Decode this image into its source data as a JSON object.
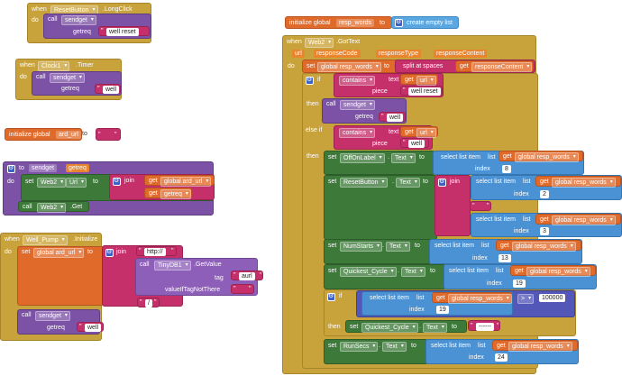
{
  "colors": {
    "event": "#c8a23a",
    "procedure": "#7c52a6",
    "variable": "#e06a2a",
    "component_setter": "#3d7a3a",
    "list": "#4a92d4",
    "text": "#c5306a",
    "control": "#c8a23a",
    "math": "#5257b8"
  },
  "block_reset": {
    "when": "when",
    "component": "ResetButton",
    "event": ".LongClick",
    "do": "do",
    "call": "call",
    "proc": "sendget",
    "param": "getreq",
    "value": "well reset"
  },
  "block_timer": {
    "when": "when",
    "component": "Clock1",
    "event": ".Timer",
    "do": "do",
    "call": "call",
    "proc": "sendget",
    "param": "getreq",
    "value": "well"
  },
  "block_init_url": {
    "label": "initialize global",
    "name": "ard_url",
    "to": "to",
    "value": " "
  },
  "block_proc": {
    "to": "to",
    "name": "sendget",
    "param": "getreq",
    "do": "do",
    "set": "set",
    "component": "Web2",
    "property": "Url",
    "to2": "to",
    "join": "join",
    "get1": "get",
    "var1": "global ard_url",
    "get2": "get",
    "var2": "getreq",
    "call": "call",
    "call_component": "Web2",
    "method": ".Get"
  },
  "block_init_pump": {
    "when": "when",
    "component": "Well_Pump",
    "event": ".Initialize",
    "do": "do",
    "set": "set",
    "var": "global ard_url",
    "to": "to",
    "join": "join",
    "text1": "http://",
    "call": "call",
    "db": "TinyDB1",
    "method": ".GetValue",
    "tag_label": "tag",
    "tag": "aurl",
    "vitnt": "valueIfTagNotThere",
    "vitnt_value": " ",
    "text3": "/",
    "call2": "call",
    "proc": "sendget",
    "param": "getreq",
    "value": "well"
  },
  "block_init_resp": {
    "label": "initialize global",
    "name": "resp_words",
    "to": "to",
    "value": "create empty list"
  },
  "block_gottext": {
    "when": "when",
    "component": "Web2",
    "event": ".GotText",
    "params": [
      "url",
      "responseCode",
      "responseType",
      "responseContent"
    ],
    "do": "do",
    "set": "set",
    "var": "global resp_words",
    "to": "to",
    "split": "split at spaces",
    "get": "get",
    "content": "responseContent",
    "if": "if",
    "contains": "contains",
    "contains_mode": "text",
    "text_label": "text",
    "piece_label": "piece",
    "get_url": "get",
    "url_var": "url",
    "piece1": "well reset",
    "then": "then",
    "call": "call",
    "call_proc": "sendget",
    "getreq": "getreq",
    "call_value": "well",
    "else_if": "else if",
    "piece2": "well",
    "select": "select list item",
    "list_label": "list",
    "index_label": "index",
    "resp_var": "global resp_words",
    "text_prop": "Text",
    "comp_offon": "OffOnLabel",
    "comp_reset": "ResetButton",
    "comp_numstarts": "NumStarts",
    "comp_quickest": "Quickest_Cycle",
    "comp_runsecs": "RunSecs",
    "join": "join",
    "join_text": " ",
    "idx_offon": "8",
    "idx_reset1": "2",
    "idx_reset2": "3",
    "idx_num": "13",
    "idx_quick": "19",
    "idx_cmp": "19",
    "cmp_op": ">",
    "cmp_value": "100000",
    "quick_value": "------",
    "idx_run": "24"
  }
}
